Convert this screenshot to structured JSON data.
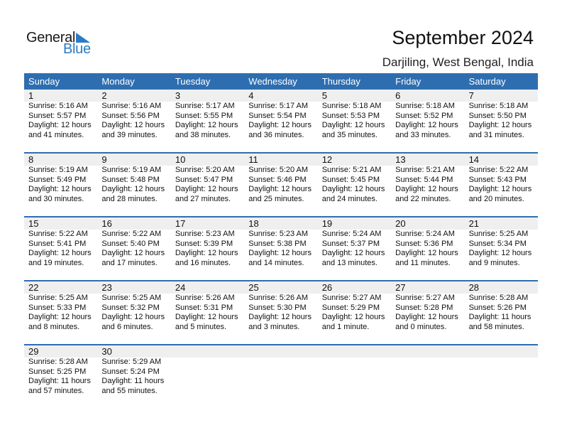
{
  "logo": {
    "word1": "General",
    "word2": "Blue"
  },
  "header": {
    "title": "September 2024",
    "location": "Darjiling, West Bengal, India"
  },
  "colors": {
    "accent": "#2e6eb0",
    "logo_blue": "#2a7bc4",
    "date_row_bg": "#efefef"
  },
  "weekdays": [
    "Sunday",
    "Monday",
    "Tuesday",
    "Wednesday",
    "Thursday",
    "Friday",
    "Saturday"
  ],
  "weeks": [
    [
      {
        "day": "1",
        "sunrise": "Sunrise: 5:16 AM",
        "sunset": "Sunset: 5:57 PM",
        "daylight1": "Daylight: 12 hours",
        "daylight2": "and 41 minutes."
      },
      {
        "day": "2",
        "sunrise": "Sunrise: 5:16 AM",
        "sunset": "Sunset: 5:56 PM",
        "daylight1": "Daylight: 12 hours",
        "daylight2": "and 39 minutes."
      },
      {
        "day": "3",
        "sunrise": "Sunrise: 5:17 AM",
        "sunset": "Sunset: 5:55 PM",
        "daylight1": "Daylight: 12 hours",
        "daylight2": "and 38 minutes."
      },
      {
        "day": "4",
        "sunrise": "Sunrise: 5:17 AM",
        "sunset": "Sunset: 5:54 PM",
        "daylight1": "Daylight: 12 hours",
        "daylight2": "and 36 minutes."
      },
      {
        "day": "5",
        "sunrise": "Sunrise: 5:18 AM",
        "sunset": "Sunset: 5:53 PM",
        "daylight1": "Daylight: 12 hours",
        "daylight2": "and 35 minutes."
      },
      {
        "day": "6",
        "sunrise": "Sunrise: 5:18 AM",
        "sunset": "Sunset: 5:52 PM",
        "daylight1": "Daylight: 12 hours",
        "daylight2": "and 33 minutes."
      },
      {
        "day": "7",
        "sunrise": "Sunrise: 5:18 AM",
        "sunset": "Sunset: 5:50 PM",
        "daylight1": "Daylight: 12 hours",
        "daylight2": "and 31 minutes."
      }
    ],
    [
      {
        "day": "8",
        "sunrise": "Sunrise: 5:19 AM",
        "sunset": "Sunset: 5:49 PM",
        "daylight1": "Daylight: 12 hours",
        "daylight2": "and 30 minutes."
      },
      {
        "day": "9",
        "sunrise": "Sunrise: 5:19 AM",
        "sunset": "Sunset: 5:48 PM",
        "daylight1": "Daylight: 12 hours",
        "daylight2": "and 28 minutes."
      },
      {
        "day": "10",
        "sunrise": "Sunrise: 5:20 AM",
        "sunset": "Sunset: 5:47 PM",
        "daylight1": "Daylight: 12 hours",
        "daylight2": "and 27 minutes."
      },
      {
        "day": "11",
        "sunrise": "Sunrise: 5:20 AM",
        "sunset": "Sunset: 5:46 PM",
        "daylight1": "Daylight: 12 hours",
        "daylight2": "and 25 minutes."
      },
      {
        "day": "12",
        "sunrise": "Sunrise: 5:21 AM",
        "sunset": "Sunset: 5:45 PM",
        "daylight1": "Daylight: 12 hours",
        "daylight2": "and 24 minutes."
      },
      {
        "day": "13",
        "sunrise": "Sunrise: 5:21 AM",
        "sunset": "Sunset: 5:44 PM",
        "daylight1": "Daylight: 12 hours",
        "daylight2": "and 22 minutes."
      },
      {
        "day": "14",
        "sunrise": "Sunrise: 5:22 AM",
        "sunset": "Sunset: 5:43 PM",
        "daylight1": "Daylight: 12 hours",
        "daylight2": "and 20 minutes."
      }
    ],
    [
      {
        "day": "15",
        "sunrise": "Sunrise: 5:22 AM",
        "sunset": "Sunset: 5:41 PM",
        "daylight1": "Daylight: 12 hours",
        "daylight2": "and 19 minutes."
      },
      {
        "day": "16",
        "sunrise": "Sunrise: 5:22 AM",
        "sunset": "Sunset: 5:40 PM",
        "daylight1": "Daylight: 12 hours",
        "daylight2": "and 17 minutes."
      },
      {
        "day": "17",
        "sunrise": "Sunrise: 5:23 AM",
        "sunset": "Sunset: 5:39 PM",
        "daylight1": "Daylight: 12 hours",
        "daylight2": "and 16 minutes."
      },
      {
        "day": "18",
        "sunrise": "Sunrise: 5:23 AM",
        "sunset": "Sunset: 5:38 PM",
        "daylight1": "Daylight: 12 hours",
        "daylight2": "and 14 minutes."
      },
      {
        "day": "19",
        "sunrise": "Sunrise: 5:24 AM",
        "sunset": "Sunset: 5:37 PM",
        "daylight1": "Daylight: 12 hours",
        "daylight2": "and 13 minutes."
      },
      {
        "day": "20",
        "sunrise": "Sunrise: 5:24 AM",
        "sunset": "Sunset: 5:36 PM",
        "daylight1": "Daylight: 12 hours",
        "daylight2": "and 11 minutes."
      },
      {
        "day": "21",
        "sunrise": "Sunrise: 5:25 AM",
        "sunset": "Sunset: 5:34 PM",
        "daylight1": "Daylight: 12 hours",
        "daylight2": "and 9 minutes."
      }
    ],
    [
      {
        "day": "22",
        "sunrise": "Sunrise: 5:25 AM",
        "sunset": "Sunset: 5:33 PM",
        "daylight1": "Daylight: 12 hours",
        "daylight2": "and 8 minutes."
      },
      {
        "day": "23",
        "sunrise": "Sunrise: 5:25 AM",
        "sunset": "Sunset: 5:32 PM",
        "daylight1": "Daylight: 12 hours",
        "daylight2": "and 6 minutes."
      },
      {
        "day": "24",
        "sunrise": "Sunrise: 5:26 AM",
        "sunset": "Sunset: 5:31 PM",
        "daylight1": "Daylight: 12 hours",
        "daylight2": "and 5 minutes."
      },
      {
        "day": "25",
        "sunrise": "Sunrise: 5:26 AM",
        "sunset": "Sunset: 5:30 PM",
        "daylight1": "Daylight: 12 hours",
        "daylight2": "and 3 minutes."
      },
      {
        "day": "26",
        "sunrise": "Sunrise: 5:27 AM",
        "sunset": "Sunset: 5:29 PM",
        "daylight1": "Daylight: 12 hours",
        "daylight2": "and 1 minute."
      },
      {
        "day": "27",
        "sunrise": "Sunrise: 5:27 AM",
        "sunset": "Sunset: 5:28 PM",
        "daylight1": "Daylight: 12 hours",
        "daylight2": "and 0 minutes."
      },
      {
        "day": "28",
        "sunrise": "Sunrise: 5:28 AM",
        "sunset": "Sunset: 5:26 PM",
        "daylight1": "Daylight: 11 hours",
        "daylight2": "and 58 minutes."
      }
    ],
    [
      {
        "day": "29",
        "sunrise": "Sunrise: 5:28 AM",
        "sunset": "Sunset: 5:25 PM",
        "daylight1": "Daylight: 11 hours",
        "daylight2": "and 57 minutes."
      },
      {
        "day": "30",
        "sunrise": "Sunrise: 5:29 AM",
        "sunset": "Sunset: 5:24 PM",
        "daylight1": "Daylight: 11 hours",
        "daylight2": "and 55 minutes."
      }
    ]
  ]
}
